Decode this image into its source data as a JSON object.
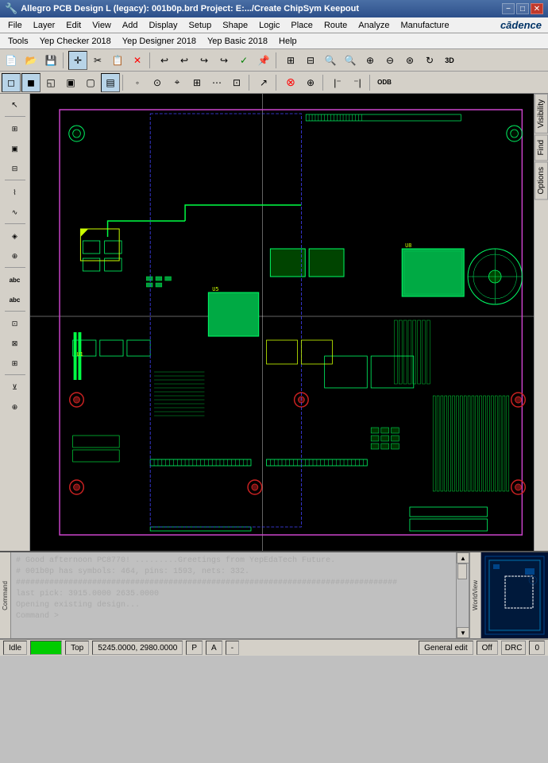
{
  "titlebar": {
    "icon": "🔧",
    "text": "Allegro PCB Design L (legacy): 001b0p.brd  Project: E:.../Create ChipSym Keepout",
    "min": "−",
    "max": "□",
    "close": "✕"
  },
  "menubar1": {
    "items": [
      "File",
      "Layer",
      "Edit",
      "View",
      "Add",
      "Display",
      "Setup",
      "Shape",
      "Logic",
      "Place",
      "Route",
      "Analyze",
      "Manufacture"
    ]
  },
  "menubar2": {
    "items": [
      "Tools",
      "Yep Checker 2018",
      "Yep Designer 2018",
      "Yep Basic 2018",
      "Help"
    ]
  },
  "right_panel_tabs": [
    "Visibility",
    "Find",
    "Options"
  ],
  "console": {
    "lines": [
      "# Good afternoon PC8770!       .........Greetings from YepEdaTech Future.",
      "# 001b0p has symbols: 464, pins: 1593, nets: 332.",
      "################################################################################",
      "last pick:  3915.0000 2635.0000",
      "Opening existing design...",
      "Command >"
    ]
  },
  "statusbar": {
    "idle": "Idle",
    "color_indicator": "",
    "layer": "Top",
    "coords": "5245.0000, 2980.0000",
    "pa": "P",
    "a": "A",
    "dash": "-",
    "mode": "General edit",
    "off": "Off",
    "drc": "DRC",
    "drc_val": "0"
  },
  "minimap": {
    "label": "WorldView"
  }
}
